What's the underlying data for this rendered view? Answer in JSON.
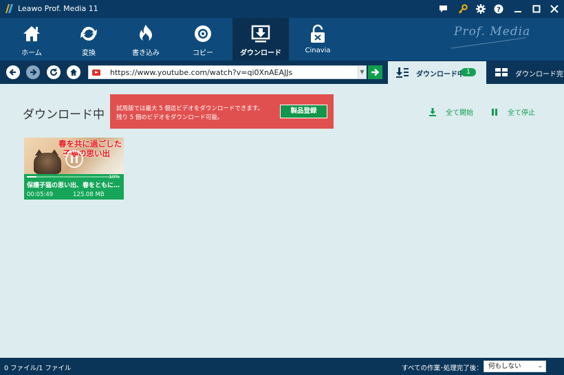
{
  "window": {
    "title": "Leawo Prof. Media 11",
    "controls": [
      "message-icon",
      "key-icon",
      "gear-icon",
      "help-icon",
      "minimize-icon",
      "maximize-icon",
      "close-icon"
    ]
  },
  "nav": {
    "items": [
      {
        "label": "ホーム",
        "icon": "home-icon"
      },
      {
        "label": "変換",
        "icon": "convert-icon"
      },
      {
        "label": "書き込み",
        "icon": "burn-icon"
      },
      {
        "label": "コピー",
        "icon": "copy-disc-icon"
      },
      {
        "label": "ダウンロード",
        "icon": "download-icon",
        "active": true
      },
      {
        "label": "Cinavia",
        "icon": "cinavia-lock-icon"
      }
    ],
    "brand": "Prof. Media"
  },
  "address": {
    "url": "https://www.youtube.com/watch?v=qi0XnAEAJJs",
    "site_icon": "youtube-icon"
  },
  "tabs": {
    "downloading_label": "ダウンロード中",
    "downloading_count": "1",
    "completed_label": "ダウンロード完了"
  },
  "main": {
    "title": "ダウンロード中",
    "trial_message": "試用版では最大 5 個迄ビデオをダウンロードできます。残り 5 個のビデオをダウンロード可能。",
    "register_label": "製品登録",
    "start_all_label": "全て開始",
    "stop_all_label": "全て停止"
  },
  "videos": [
    {
      "thumb_caption_line1": "春を共に過ごした",
      "thumb_caption_line2": "子猫の思い出",
      "title": "保護子猫の思い出、春をともに…",
      "duration": "00:05:49",
      "size": "125.08 MB",
      "progress_percent": 10,
      "progress_label": "10%"
    }
  ],
  "status": {
    "file_count": "0 ファイル/1 ファイル",
    "after_label": "すべての作業･処理完了後：",
    "after_value": "何もしない"
  },
  "colors": {
    "accent_green": "#0f9e4e",
    "banner_red": "#e0504f",
    "nav_blue": "#0e4b7c",
    "content_bg": "#ddecef"
  }
}
